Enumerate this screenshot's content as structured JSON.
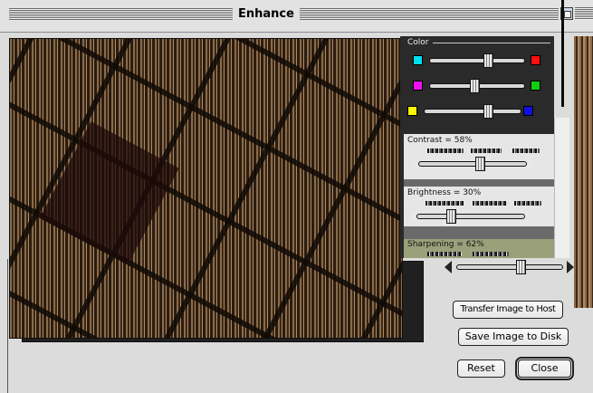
{
  "window": {
    "title": "Enhance"
  },
  "color_group": {
    "label": "Color",
    "rows": [
      {
        "left_swatch": "#00e0f0",
        "right_swatch": "#ff1010",
        "value": 0.63
      },
      {
        "left_swatch": "#f010f0",
        "right_swatch": "#10d010",
        "value": 0.47
      },
      {
        "left_swatch": "#f8f800",
        "right_swatch": "#1010e0",
        "value": 0.68
      }
    ]
  },
  "contrast": {
    "label": "Contrast = 58%",
    "value": 0.58
  },
  "brightness": {
    "label": "Brightness = 30%",
    "value": 0.3
  },
  "sharpening": {
    "label": "Sharpening = 62%",
    "value": 0.62
  },
  "buttons": {
    "transfer": "Transfer Image to Host",
    "save": "Save Image to Disk",
    "reset": "Reset",
    "close": "Close"
  },
  "icons": {
    "zoom": "zoom-box-icon",
    "arrow_left": "left-arrow-icon",
    "arrow_right": "right-arrow-icon"
  }
}
